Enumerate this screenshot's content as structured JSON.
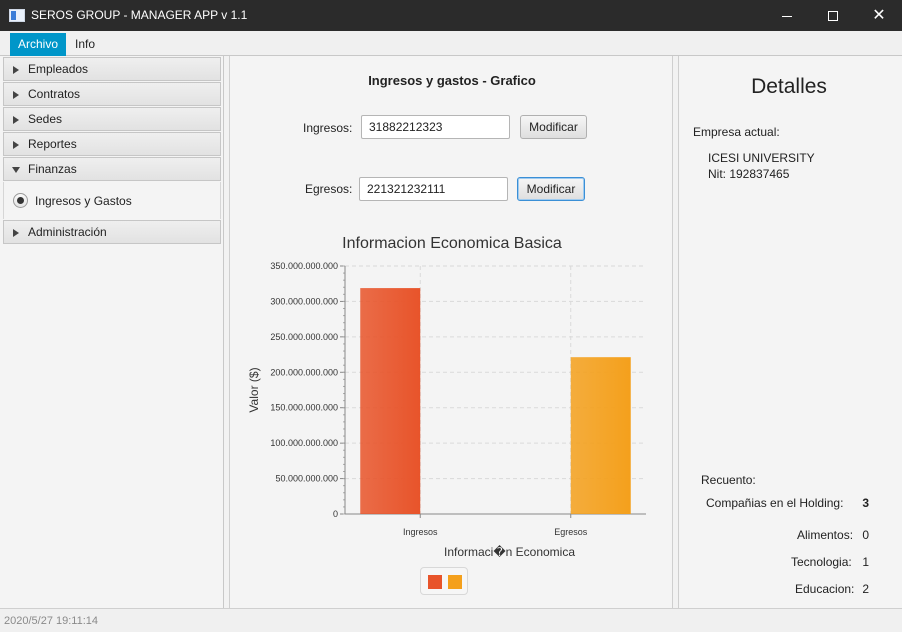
{
  "window": {
    "title": "SEROS GROUP - MANAGER APP  v 1.1",
    "minimize_icon": "minimize-icon",
    "maximize_icon": "maximize-icon",
    "close_icon": "close-icon"
  },
  "menubar": {
    "items": [
      {
        "label": "Archivo",
        "active": true
      },
      {
        "label": "Info",
        "active": false
      }
    ]
  },
  "sidebar": {
    "sections": [
      {
        "label": "Empleados",
        "expanded": false
      },
      {
        "label": "Contratos",
        "expanded": false
      },
      {
        "label": "Sedes",
        "expanded": false
      },
      {
        "label": "Reportes",
        "expanded": false
      },
      {
        "label": "Finanzas",
        "expanded": true
      },
      {
        "label": "Administración",
        "expanded": false
      }
    ],
    "finanzas_option": {
      "label": "Ingresos y Gastos",
      "selected": true
    }
  },
  "center": {
    "title": "Ingresos y gastos - Grafico",
    "ingresos": {
      "label": "Ingresos:",
      "value": "31882212323",
      "button": "Modificar"
    },
    "egresos": {
      "label": "Egresos:",
      "value": "221321232111",
      "button": "Modificar"
    }
  },
  "chart_data": {
    "type": "bar",
    "title": "Informacion Economica Basica",
    "xlabel": "Informaci�n Economica",
    "ylabel": "Valor ($)",
    "categories": [
      "Ingresos",
      "Egresos"
    ],
    "series": [
      {
        "values": [
          318822123230,
          null
        ],
        "color": "#e8542a"
      },
      {
        "values": [
          null,
          221321232111
        ],
        "color": "#f4a01c"
      }
    ],
    "ylim": [
      0,
      350000000000
    ],
    "yticks": [
      0,
      50000000000,
      100000000000,
      150000000000,
      200000000000,
      250000000000,
      300000000000,
      350000000000
    ],
    "ytick_labels": [
      "0",
      "50.000.000.000",
      "100.000.000.000",
      "150.000.000.000",
      "200.000.000.000",
      "250.000.000.000",
      "300.000.000.000",
      "350.000.000.000"
    ],
    "grid": true,
    "legend": "bottom"
  },
  "right": {
    "title": "Detalles",
    "empresa_label": "Empresa actual:",
    "empresa_name": "ICESI UNIVERSITY",
    "empresa_nit": "Nit: 192837465",
    "recuento_label": "Recuento:",
    "counts": [
      {
        "label": "Compañias en el Holding:",
        "value": "3",
        "bold": true
      },
      {
        "label": "Alimentos:",
        "value": "0",
        "bold": false
      },
      {
        "label": "Tecnologia:",
        "value": "1",
        "bold": false
      },
      {
        "label": "Educacion:",
        "value": "2",
        "bold": false
      }
    ]
  },
  "status": {
    "datetime": "2020/5/27   19:11:14"
  }
}
